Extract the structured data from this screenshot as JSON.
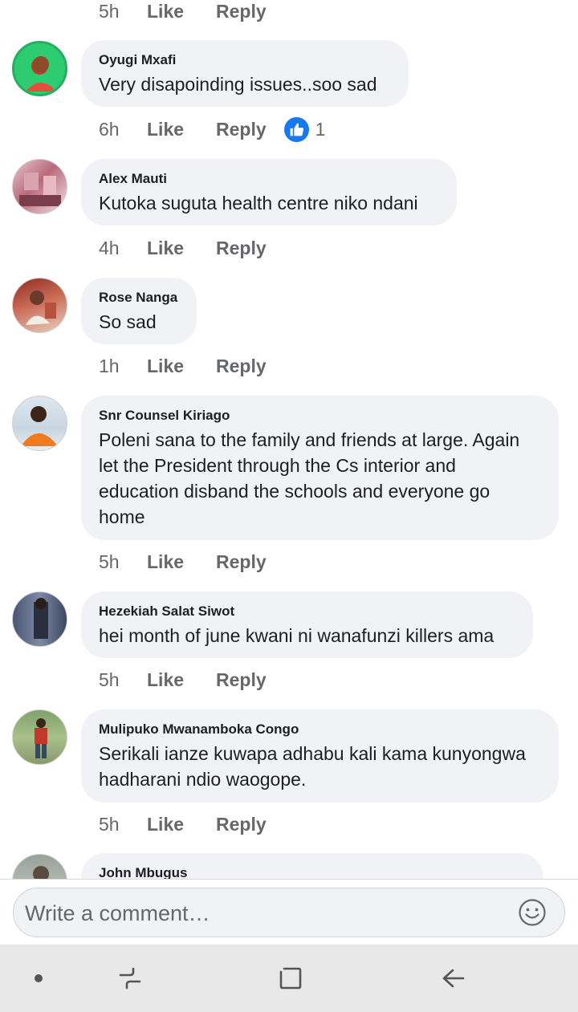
{
  "colors": {
    "accent": "#1877f2",
    "bubble": "#f0f2f5",
    "meta": "#65676b",
    "navbar": "#e8e8e8"
  },
  "actions": {
    "like": "Like",
    "reply": "Reply"
  },
  "top_partial": {
    "time": "5h"
  },
  "comments": [
    {
      "name": "Oyugi Mxafi",
      "text": "Very disapoinding issues..soo sad",
      "time": "6h",
      "reactions": {
        "icon": "like-icon",
        "count": "1"
      }
    },
    {
      "name": "Alex Mauti",
      "text": "Kutoka suguta health centre niko ndani",
      "time": "4h"
    },
    {
      "name": "Rose Nanga",
      "text": "So sad",
      "time": "1h"
    },
    {
      "name": "Snr Counsel Kiriago",
      "text_lines": [
        "Poleni sana to the family and friends at large. Again",
        "let the President through the Cs interior and",
        "education disband the schools and everyone go",
        "home"
      ],
      "time": "5h"
    },
    {
      "name": "Hezekiah Salat Siwot",
      "text": "hei month of june kwani ni wanafunzi killers ama",
      "time": "5h"
    },
    {
      "name": "Mulipuko Mwanamboka Congo",
      "text_lines": [
        "Serikali ianze kuwapa adhabu kali kama kunyongwa",
        "hadharani ndio waogope."
      ],
      "time": "5h"
    },
    {
      "name": "John Mbugus"
    }
  ],
  "composer": {
    "placeholder": "Write a comment…",
    "emoji_icon": "smiley-icon"
  },
  "navbar": {
    "icons": [
      "dot-icon",
      "recent-apps-icon",
      "home-icon",
      "back-icon"
    ]
  }
}
